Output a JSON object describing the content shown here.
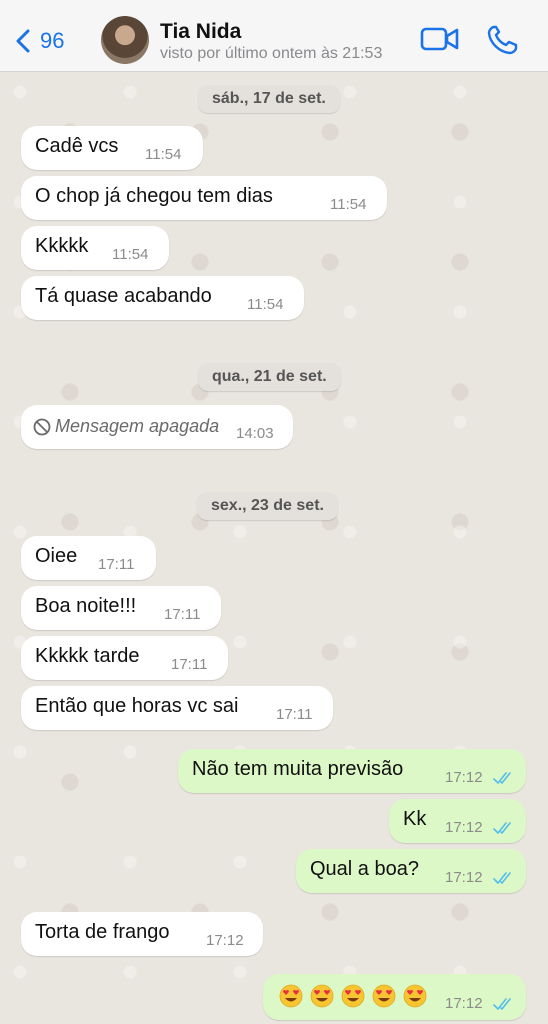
{
  "header": {
    "back_count": "96",
    "contact_name": "Tia Nida",
    "status": "visto por último ontem às 21:53",
    "icons": {
      "back": "chevron-left-icon",
      "video": "video-camera-icon",
      "call": "phone-icon"
    }
  },
  "dates": {
    "d1": "sáb., 17 de set.",
    "d2": "qua., 21 de set.",
    "d3": "sex., 23 de set."
  },
  "messages": [
    {
      "dir": "in",
      "text": "Cadê vcs",
      "time": "11:54"
    },
    {
      "dir": "in",
      "text": "O chop já chegou tem dias",
      "time": "11:54"
    },
    {
      "dir": "in",
      "text": "Kkkkk",
      "time": "11:54"
    },
    {
      "dir": "in",
      "text": "Tá quase acabando",
      "time": "11:54"
    },
    {
      "dir": "in",
      "text": "Mensagem apagada",
      "time": "14:03",
      "deleted": true
    },
    {
      "dir": "in",
      "text": "Oiee",
      "time": "17:11"
    },
    {
      "dir": "in",
      "text": "Boa noite!!!",
      "time": "17:11"
    },
    {
      "dir": "in",
      "text": "Kkkkk tarde",
      "time": "17:11"
    },
    {
      "dir": "in",
      "text": "Então que horas vc sai",
      "time": "17:11"
    },
    {
      "dir": "out",
      "text": "Não tem muita previsão",
      "time": "17:12",
      "read": true
    },
    {
      "dir": "out",
      "text": "Kk",
      "time": "17:12",
      "read": true
    },
    {
      "dir": "out",
      "text": "Qual a boa?",
      "time": "17:12",
      "read": true
    },
    {
      "dir": "in",
      "text": "Torta de frango",
      "time": "17:12"
    },
    {
      "dir": "out",
      "emoji": "heart-eyes-emoji",
      "emoji_count": 5,
      "time": "17:12",
      "read": true
    }
  ],
  "colors": {
    "accent": "#1a73e8",
    "outgoing_bubble": "#dcf8c6",
    "incoming_bubble": "#ffffff",
    "read_ticks": "#53bdeb"
  }
}
